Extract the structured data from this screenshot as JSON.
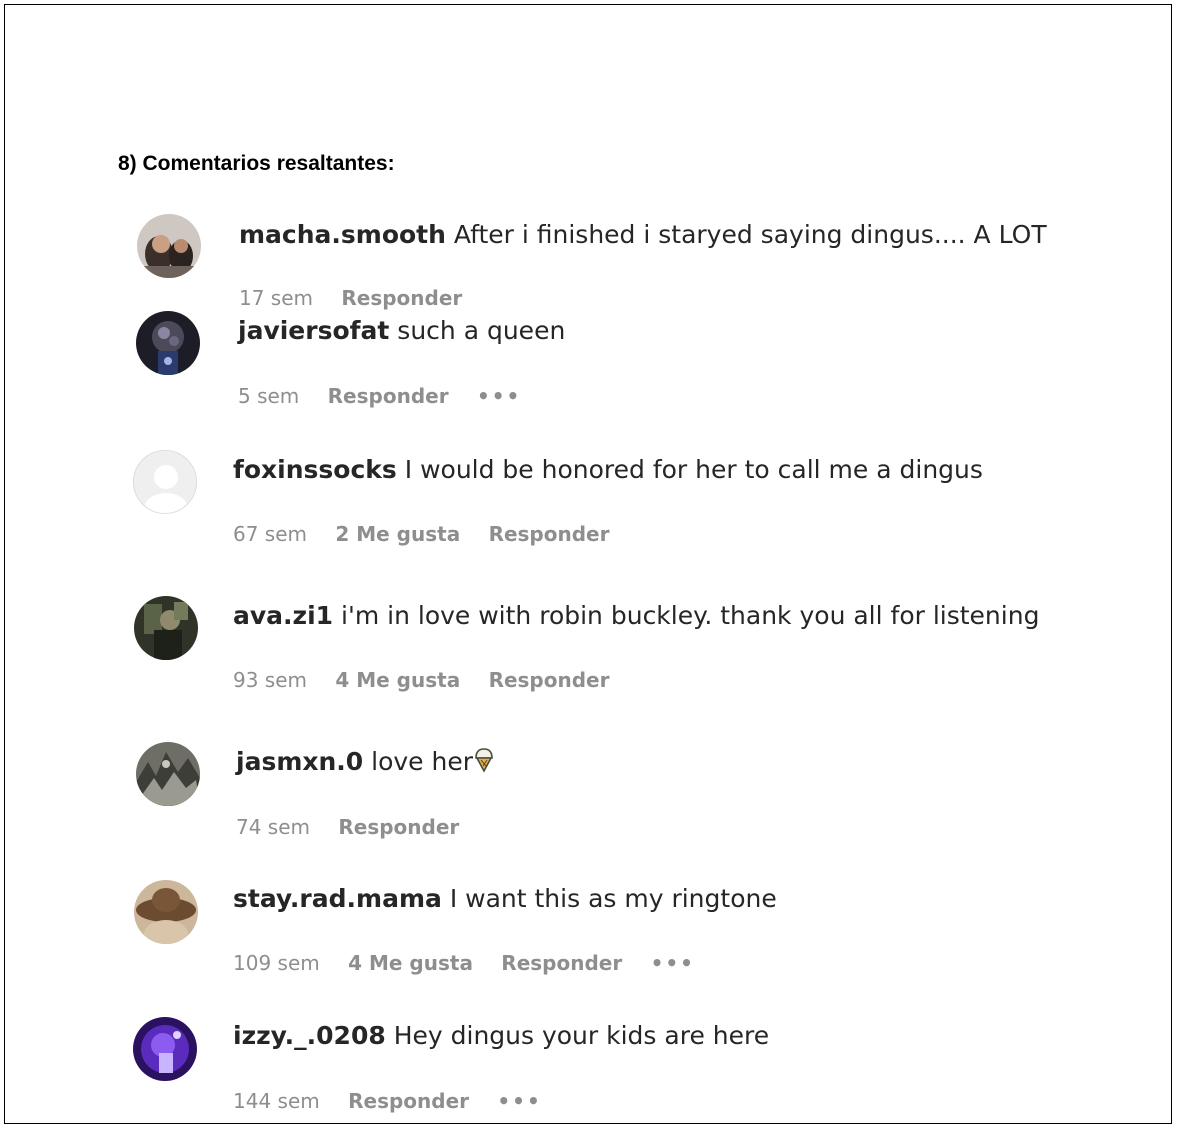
{
  "heading": "8) Comentarios resaltantes:",
  "comments": [
    {
      "username": "macha.smooth",
      "text": "After i finished i staryed saying dingus.... A LOT",
      "time": "17 sem",
      "likes": "",
      "reply": "Responder",
      "more": "",
      "avatar": "photo-avatar-1"
    },
    {
      "username": "javiersofat",
      "text": "such a queen",
      "time": "5 sem",
      "likes": "",
      "reply": "Responder",
      "more": "•••",
      "avatar": "photo-avatar-2"
    },
    {
      "username": "foxinssocks",
      "text": "I would be honored for her to call me a dingus",
      "time": "67 sem",
      "likes": "2 Me gusta",
      "reply": "Responder",
      "more": "",
      "avatar": "default-avatar"
    },
    {
      "username": "ava.zi1",
      "text": "i'm in love with robin buckley. thank you all for listening",
      "time": "93 sem",
      "likes": "4 Me gusta",
      "reply": "Responder",
      "more": "",
      "avatar": "photo-avatar-3"
    },
    {
      "username": "jasmxn.0",
      "text": "love her",
      "time": "74 sem",
      "likes": "",
      "reply": "Responder",
      "more": "",
      "avatar": "photo-avatar-4",
      "emoji": "ice-cream-icon"
    },
    {
      "username": "stay.rad.mama",
      "text": "I want this as my ringtone",
      "time": "109 sem",
      "likes": "4 Me gusta",
      "reply": "Responder",
      "more": "•••",
      "avatar": "photo-avatar-5"
    },
    {
      "username": "izzy._.0208",
      "text": "Hey dingus your kids are here",
      "time": "144 sem",
      "likes": "",
      "reply": "Responder",
      "more": "•••",
      "avatar": "photo-avatar-6"
    }
  ]
}
